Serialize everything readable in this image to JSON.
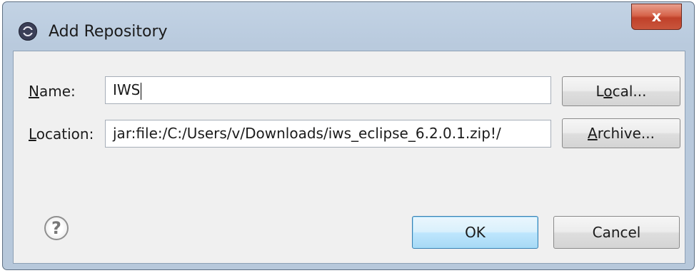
{
  "window": {
    "title": "Add Repository",
    "close_glyph": "x",
    "app_icon": "eclipse-icon"
  },
  "form": {
    "name_label_mnemonic": "N",
    "name_label_rest": "ame:",
    "name_value": "IWS",
    "location_label_mnemonic": "L",
    "location_label_rest": "ocation:",
    "location_value": "jar:file:/C:/Users/v/Downloads/iws_eclipse_6.2.0.1.zip!/"
  },
  "buttons": {
    "local_pre": "L",
    "local_mnemonic": "o",
    "local_post": "cal...",
    "archive_mnemonic": "A",
    "archive_rest": "rchive...",
    "ok_label": "OK",
    "cancel_label": "Cancel"
  },
  "help": {
    "glyph": "?",
    "icon": "help-icon"
  }
}
